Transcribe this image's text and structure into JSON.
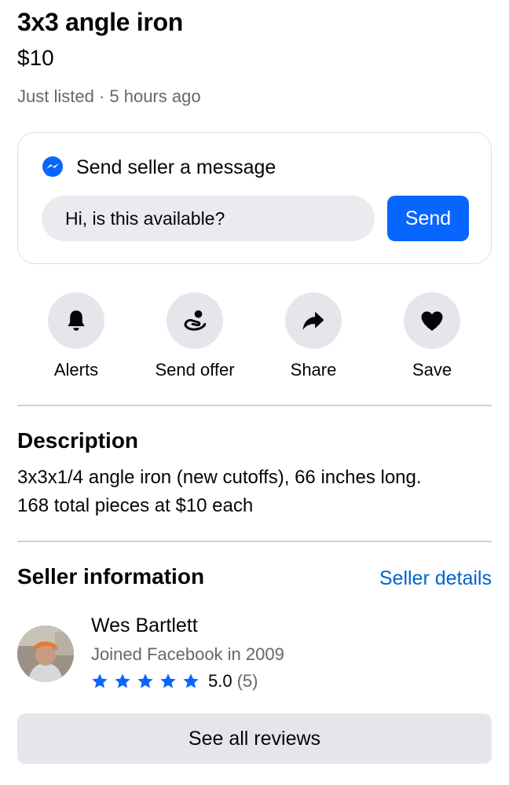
{
  "listing": {
    "title": "3x3 angle iron",
    "price": "$10",
    "meta": "Just listed · 5 hours ago"
  },
  "message": {
    "heading": "Send seller a message",
    "input_value": "Hi, is this available?",
    "send_label": "Send",
    "icon": "messenger-icon"
  },
  "actions": [
    {
      "label": "Alerts",
      "icon": "bell-icon"
    },
    {
      "label": "Send offer",
      "icon": "offer-hand-icon"
    },
    {
      "label": "Share",
      "icon": "share-arrow-icon"
    },
    {
      "label": "Save",
      "icon": "heart-icon"
    }
  ],
  "description": {
    "heading": "Description",
    "line1": "3x3x1/4 angle iron (new cutoffs), 66 inches long.",
    "line2": "168 total pieces at $10 each"
  },
  "seller": {
    "heading": "Seller information",
    "details_link": "Seller details",
    "name": "Wes Bartlett",
    "joined": "Joined Facebook in 2009",
    "rating": {
      "stars": 5,
      "score": "5.0",
      "count": "(5)"
    },
    "reviews_button": "See all reviews"
  },
  "colors": {
    "accent": "#0866ff",
    "link": "#0064d1",
    "secondary_text": "#65676b",
    "button_bg": "#e4e6eb"
  }
}
